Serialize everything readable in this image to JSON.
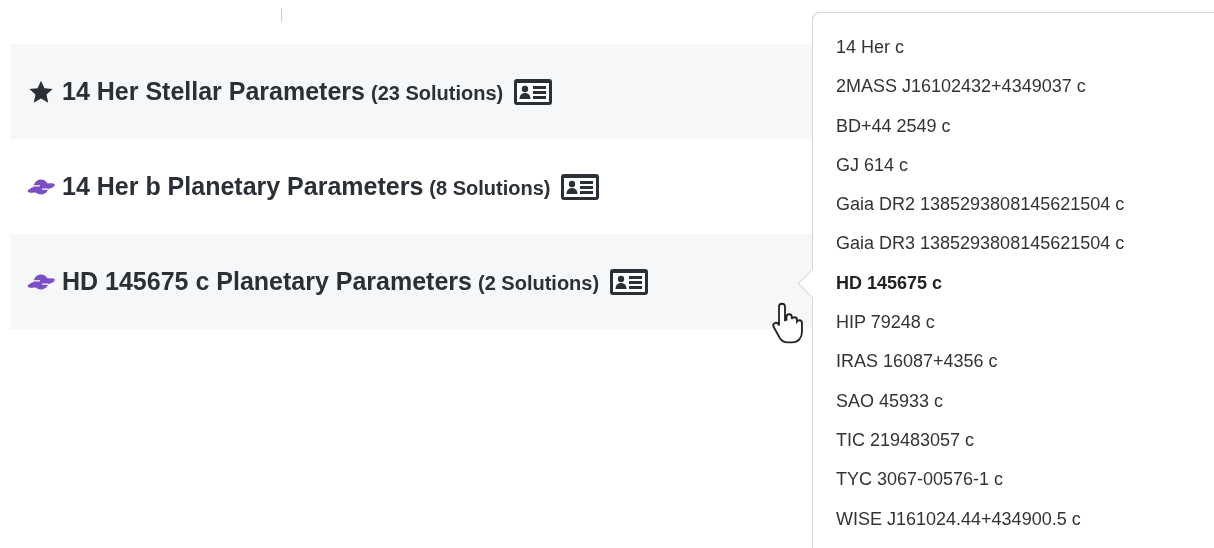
{
  "rows": [
    {
      "kind": "star",
      "title": "14 Her Stellar Parameters",
      "count": "(23 Solutions)"
    },
    {
      "kind": "planet",
      "title": "14 Her b Planetary Parameters",
      "count": "(8 Solutions)"
    },
    {
      "kind": "planet",
      "title": "HD 145675 c Planetary Parameters",
      "count": "(2 Solutions)"
    }
  ],
  "popover": {
    "names": [
      {
        "label": "14 Her c",
        "selected": false
      },
      {
        "label": "2MASS J16102432+4349037 c",
        "selected": false
      },
      {
        "label": "BD+44 2549 c",
        "selected": false
      },
      {
        "label": "GJ 614 c",
        "selected": false
      },
      {
        "label": "Gaia DR2 1385293808145621504 c",
        "selected": false
      },
      {
        "label": "Gaia DR3 1385293808145621504 c",
        "selected": false
      },
      {
        "label": "HD 145675 c",
        "selected": true
      },
      {
        "label": "HIP 79248 c",
        "selected": false
      },
      {
        "label": "IRAS 16087+4356 c",
        "selected": false
      },
      {
        "label": "SAO 45933 c",
        "selected": false
      },
      {
        "label": "TIC 219483057 c",
        "selected": false
      },
      {
        "label": "TYC 3067-00576-1 c",
        "selected": false
      },
      {
        "label": "WISE J161024.44+434900.5 c",
        "selected": false
      }
    ]
  }
}
